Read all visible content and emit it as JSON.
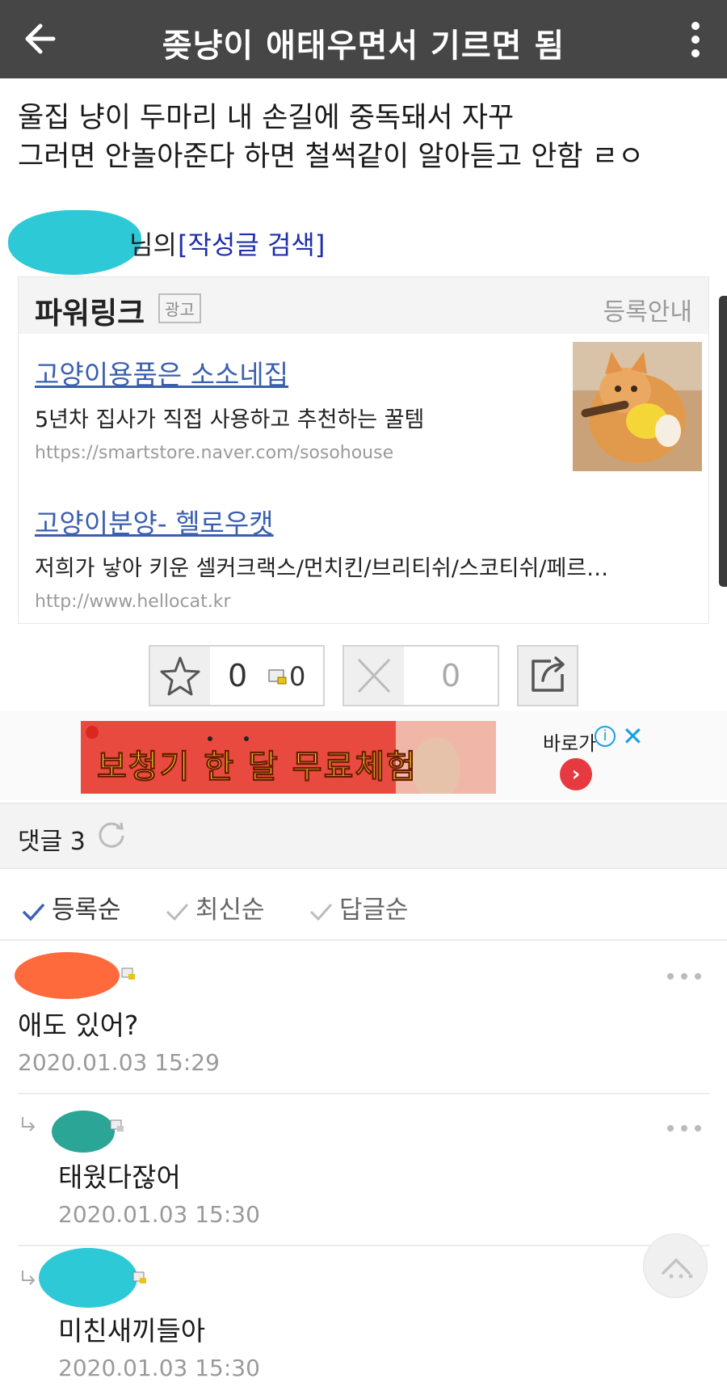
{
  "header": {
    "title": "좆냥이 애태우면서 기르면 됨",
    "back_icon": "arrow-left-icon",
    "menu_icon": "vertical-dots-icon"
  },
  "post": {
    "lines": [
      "울집 냥이 두마리 내 손길에 중독돼서 자꾸",
      "그러면 안놀아준다 하면 철썩같이 알아듣고 안함 ㄹㅇ"
    ]
  },
  "author": {
    "suffix": "님의",
    "search_label": "[작성글 검색]"
  },
  "powerlink": {
    "title": "파워링크",
    "ad_badge": "광고",
    "register_label": "등록안내",
    "ads": [
      {
        "title": "고양이용품은 소소네집",
        "desc": "5년차 집사가 직접 사용하고 추천하는 꿀템",
        "url": "https://smartstore.naver.com/sosohouse"
      },
      {
        "title": "고양이분양- 헬로우캣",
        "desc": "저희가 낳아 키운 셀커크랙스/먼치킨/브리티쉬/스코티쉬/페르…",
        "url": "http://www.hellocat.kr"
      }
    ]
  },
  "votes": {
    "recommend_count": "0",
    "level_count": "0",
    "unrecommend_count": "0"
  },
  "banner": {
    "text": "보청기 한 달 무료체험",
    "side_label": "바로가",
    "info_label": "i",
    "close_label": "✕",
    "go_label": "›"
  },
  "comments_header": {
    "label": "댓글 3"
  },
  "sort": {
    "items": [
      "등록순",
      "최신순",
      "답글순"
    ],
    "active": "등록순"
  },
  "comments": [
    {
      "text": "애도 있어?",
      "date": "2020.01.03 15:29"
    },
    {
      "text": "태웠다잖어",
      "date": "2020.01.03 15:30"
    },
    {
      "text": "미친새끼들아",
      "date": "2020.01.03 15:30"
    }
  ],
  "colors": {
    "topbar": "#464646",
    "link_blue": "#3a5fb0",
    "search_blue": "#1f2fa8",
    "author_mask": "#2ec9d6",
    "commenter1_mask": "#ff6a3d",
    "commenter2_mask": "#2aa596",
    "commenter3_mask": "#2ec9d6"
  }
}
